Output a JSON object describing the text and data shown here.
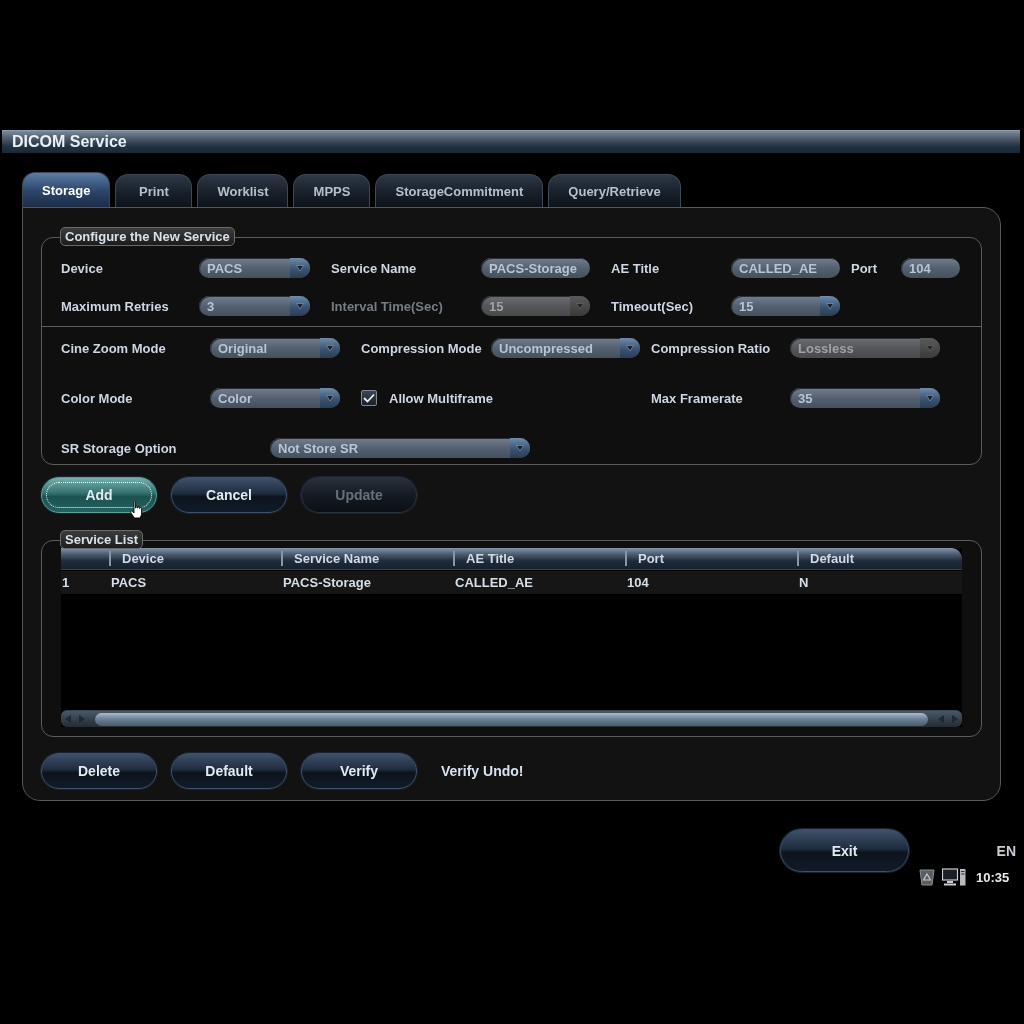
{
  "window": {
    "title": "DICOM Service"
  },
  "tabs": [
    {
      "label": "Storage",
      "selected": true
    },
    {
      "label": "Print",
      "selected": false
    },
    {
      "label": "Worklist",
      "selected": false
    },
    {
      "label": "MPPS",
      "selected": false
    },
    {
      "label": "StorageCommitment",
      "selected": false
    },
    {
      "label": "Query/Retrieve",
      "selected": false
    }
  ],
  "configure": {
    "legend": "Configure the New Service",
    "sections": [
      {
        "rows": [
          [
            {
              "kind": "combo",
              "label": "Device",
              "value": "PACS",
              "disabled": false,
              "label_greyed": false
            },
            {
              "kind": "text",
              "label": "Service Name",
              "value": "PACS-Storage",
              "disabled": false,
              "label_greyed": false
            },
            {
              "kind": "text",
              "label": "AE Title",
              "value": "CALLED_AE",
              "disabled": false,
              "label_greyed": false
            },
            {
              "kind": "text",
              "label": "Port",
              "value": "104",
              "disabled": false,
              "label_greyed": false
            }
          ],
          [
            {
              "kind": "combo",
              "label": "Maximum Retries",
              "value": "3",
              "disabled": false,
              "label_greyed": false
            },
            {
              "kind": "combo",
              "label": "Interval Time(Sec)",
              "value": "15",
              "disabled": true,
              "label_greyed": true
            },
            {
              "kind": "combo",
              "label": "Timeout(Sec)",
              "value": "15",
              "disabled": false,
              "label_greyed": false
            }
          ]
        ]
      },
      {
        "rows": [
          [
            {
              "kind": "combo",
              "label": "Cine Zoom Mode",
              "value": "Original",
              "disabled": false,
              "label_greyed": false
            },
            {
              "kind": "combo",
              "label": "Compression Mode",
              "value": "Uncompressed",
              "disabled": false,
              "label_greyed": false
            },
            {
              "kind": "combo",
              "label": "Compression Ratio",
              "value": "Lossless",
              "disabled": true,
              "label_greyed": false
            }
          ],
          [
            {
              "kind": "combo",
              "label": "Color Mode",
              "value": "Color",
              "disabled": false,
              "label_greyed": false
            },
            {
              "kind": "checkbox",
              "label": "Allow Multiframe",
              "checked": true
            },
            {
              "kind": "combo",
              "label": "Max Framerate",
              "value": "35",
              "disabled": false,
              "label_greyed": false
            }
          ],
          [
            {
              "kind": "combo",
              "label": "SR Storage Option",
              "value": "Not Store SR",
              "disabled": false,
              "label_greyed": false
            }
          ]
        ]
      }
    ]
  },
  "actions": [
    {
      "label": "Add",
      "focused": true,
      "disabled": false
    },
    {
      "label": "Cancel",
      "focused": false,
      "disabled": false
    },
    {
      "label": "Update",
      "focused": false,
      "disabled": true
    }
  ],
  "service_list": {
    "legend": "Service List",
    "columns": [
      "Device",
      "Service Name",
      "AE Title",
      "Port",
      "Default"
    ],
    "rows": [
      {
        "number": "1",
        "cells": [
          "PACS",
          "PACS-Storage",
          "CALLED_AE",
          "104",
          "N"
        ]
      }
    ]
  },
  "list_actions": [
    {
      "label": "Delete",
      "disabled": false
    },
    {
      "label": "Default",
      "disabled": false
    },
    {
      "label": "Verify",
      "disabled": false
    }
  ],
  "verify_status": "Verify Undo!",
  "exit_button": {
    "label": "Exit"
  },
  "status_bar": {
    "language": "EN",
    "time": "10:35"
  }
}
